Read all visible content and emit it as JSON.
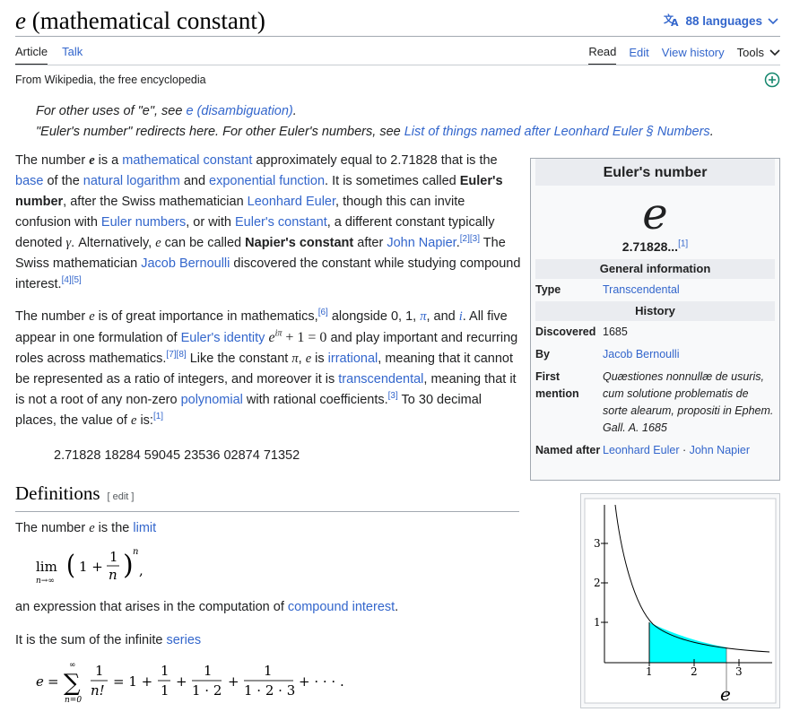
{
  "header": {
    "title_symbol": "e",
    "title_rest": " (mathematical constant)",
    "languages_label": "88 languages"
  },
  "tabs": {
    "article": "Article",
    "talk": "Talk",
    "read": "Read",
    "edit": "Edit",
    "history": "View history",
    "tools": "Tools"
  },
  "tagline": "From Wikipedia, the free encyclopedia",
  "hatnotes": {
    "h1_pre": "For other uses of \"e\", see ",
    "h1_link": "e (disambiguation)",
    "h1_post": ".",
    "h2_pre": "\"Euler's number\" redirects here. For other Euler's numbers, see ",
    "h2_link": "List of things named after Leonhard Euler § Numbers",
    "h2_post": "."
  },
  "section": {
    "title": "Definitions",
    "edit": "[ edit ]"
  },
  "decimals": "2.71828 18284 59045 23536 02874 71352",
  "infobox": {
    "title": "Euler's number",
    "symbol": "e",
    "value": "2.71828...",
    "value_ref": "[1]",
    "sec_general": "General information",
    "type_k": "Type",
    "type_v": "Transcendental",
    "sec_history": "History",
    "disc_k": "Discovered",
    "disc_v": "1685",
    "by_k": "By",
    "by_v": "Jacob Bernoulli",
    "first_k": "First mention",
    "first_v": "Quæstiones nonnullæ de usuris, cum solutione problematis de sorte alearum, propositi in Ephem. Gall. A. 1685",
    "named_k": "Named after",
    "named_v1": "Leonhard Euler",
    "named_sep": " · ",
    "named_v2": "John Napier"
  },
  "graph": {
    "y_ticks": [
      "1",
      "2",
      "3"
    ],
    "x_ticks": [
      "1",
      "2",
      "3"
    ],
    "e_label": "e",
    "area_color": "#00ffff"
  },
  "colors": {
    "link": "#3366cc",
    "text": "#202122"
  }
}
